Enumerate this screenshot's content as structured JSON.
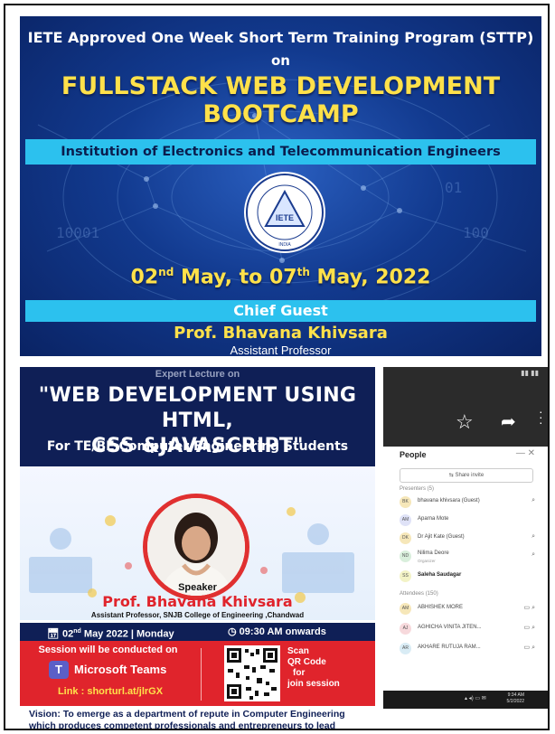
{
  "poster1": {
    "title_line1": "IETE Approved One Week Short Term Training Program (STTP)",
    "on": "on",
    "main_line1": "FULLSTACK WEB DEVELOPMENT",
    "main_line2": "BOOTCAMP",
    "institution": "Institution of Electronics and Telecommunication Engineers",
    "logo_text": "IETE",
    "logo_ring_text": "THE INSTITUTION OF ELECTRONICS AND TELECOMMUNICATION ENGINEERS",
    "logo_india": "INDIA",
    "date_start_day": "02",
    "date_start_sup": "nd",
    "date_start_rest": " May,  to 07",
    "date_end_sup": "th",
    "date_end_rest": " May, 2022",
    "chief_guest_label": "Chief Guest",
    "speaker_name": "Prof. Bhavana Khivsara",
    "speaker_designation": "Assistant Professor"
  },
  "poster2": {
    "ghost_header": "Expert Lecture on",
    "title_line1": "\"WEB DEVELOPMENT USING HTML,",
    "title_line2": "CSS &JAVASCRIPT\"",
    "subtitle": "For TE/BE Computer Engineering Students",
    "speaker_label": "Speaker",
    "speaker_name": "Prof. Bhavana Khivsara",
    "affiliation": "Assistant Professor, SNJB College of Engineering ,Chandwad",
    "date_day": "02",
    "date_sup": "nd",
    "date_rest": " May 2022  |  Monday",
    "time": "09:30 AM onwards",
    "session_line1": "Session will be conducted on",
    "platform": "Microsoft Teams",
    "link": "Link : shorturl.at/jlrGX",
    "scan_text_1": "Scan",
    "scan_text_2": "QR Code",
    "scan_text_3": "for",
    "scan_text_4": "join session",
    "vision": "Vision: To emerge as a department of repute in Computer Engineering which produces competent professionals and entrepreneurs to lead"
  },
  "phone": {
    "people_title": "People",
    "share_invite": "Share invite",
    "presenters_label": "Presenters (5)",
    "presenters": [
      {
        "initials": "BK",
        "name": "bhavana khivsara (Guest)",
        "color": "#f6e7b9"
      },
      {
        "initials": "AM",
        "name": "Aparna Mote",
        "color": "#dfe2f7"
      },
      {
        "initials": "DK",
        "name": "Dr Ajit Kate (Guest)",
        "color": "#f6e7b9"
      },
      {
        "initials": "ND",
        "name": "Nilima Deore",
        "color": "#d9efdc",
        "sub": "Organizer"
      },
      {
        "initials": "SS",
        "name": "Saleha Saudagar",
        "color": "#f3f3c6"
      }
    ],
    "attendees_label": "Attendees (150)",
    "attendees": [
      {
        "initials": "AM",
        "name": "ABHISHEK MORE",
        "color": "#f6e7b9"
      },
      {
        "initials": "AJ",
        "name": "AGHICHA VINITA JITEN...",
        "color": "#f7d9dc"
      },
      {
        "initials": "AR",
        "name": "AKHARE RUTUJA RAM...",
        "color": "#d9ecf5"
      }
    ],
    "taskbar_time": "9:34 AM",
    "taskbar_date": "5/2/2022"
  }
}
